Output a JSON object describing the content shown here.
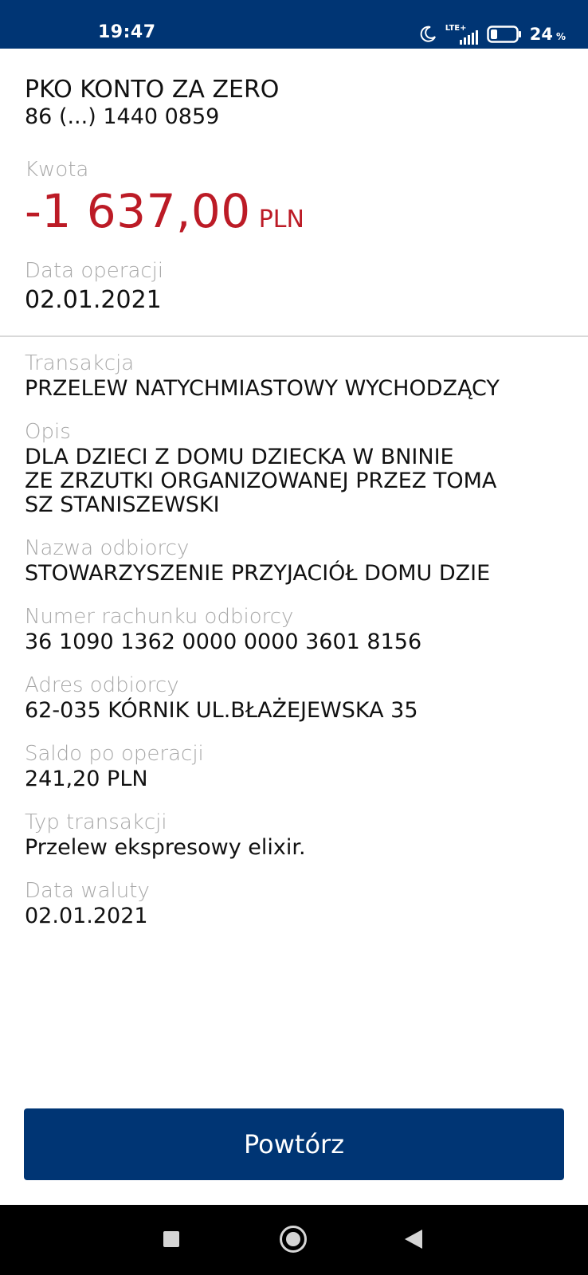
{
  "status_bar": {
    "time": "19:47",
    "network": "LTE+",
    "battery_percent": "24",
    "battery_unit": "%",
    "icons": [
      "moon-icon",
      "signal-icon",
      "battery-icon"
    ]
  },
  "account": {
    "name": "PKO KONTO ZA ZERO",
    "number": "86 (...) 1440 0859"
  },
  "amount": {
    "label": "Kwota",
    "value": "-1 637,00",
    "currency": "PLN",
    "color": "#bc1b26"
  },
  "operation_date": {
    "label": "Data operacji",
    "value": "02.01.2021"
  },
  "details": {
    "transaction": {
      "label": "Transakcja",
      "value": "PRZELEW NATYCHMIASTOWY WYCHODZĄCY"
    },
    "description": {
      "label": "Opis",
      "value": "DLA DZIECI Z DOMU DZIECKA W BNINIE\nZE ZRZUTKI ORGANIZOWANEJ PRZEZ TOMA\nSZ STANISZEWSKI"
    },
    "recipient_name": {
      "label": "Nazwa odbiorcy",
      "value": "STOWARZYSZENIE PRZYJACIÓŁ DOMU DZIE"
    },
    "recipient_account": {
      "label": "Numer rachunku odbiorcy",
      "value": "36 1090 1362 0000 0000 3601 8156"
    },
    "recipient_address": {
      "label": "Adres odbiorcy",
      "value": "62-035 KÓRNIK UL.BŁAŻEJEWSKA 35"
    },
    "balance_after": {
      "label": "Saldo po operacji",
      "value": "241,20 PLN"
    },
    "transaction_type": {
      "label": "Typ transakcji",
      "value": "Przelew ekspresowy elixir."
    },
    "value_date": {
      "label": "Data waluty",
      "value": "02.01.2021"
    }
  },
  "actions": {
    "repeat_label": "Powtórz"
  },
  "colors": {
    "brand": "#003574",
    "amount_negative": "#bc1b26",
    "label_gray": "#a8a8a8"
  }
}
